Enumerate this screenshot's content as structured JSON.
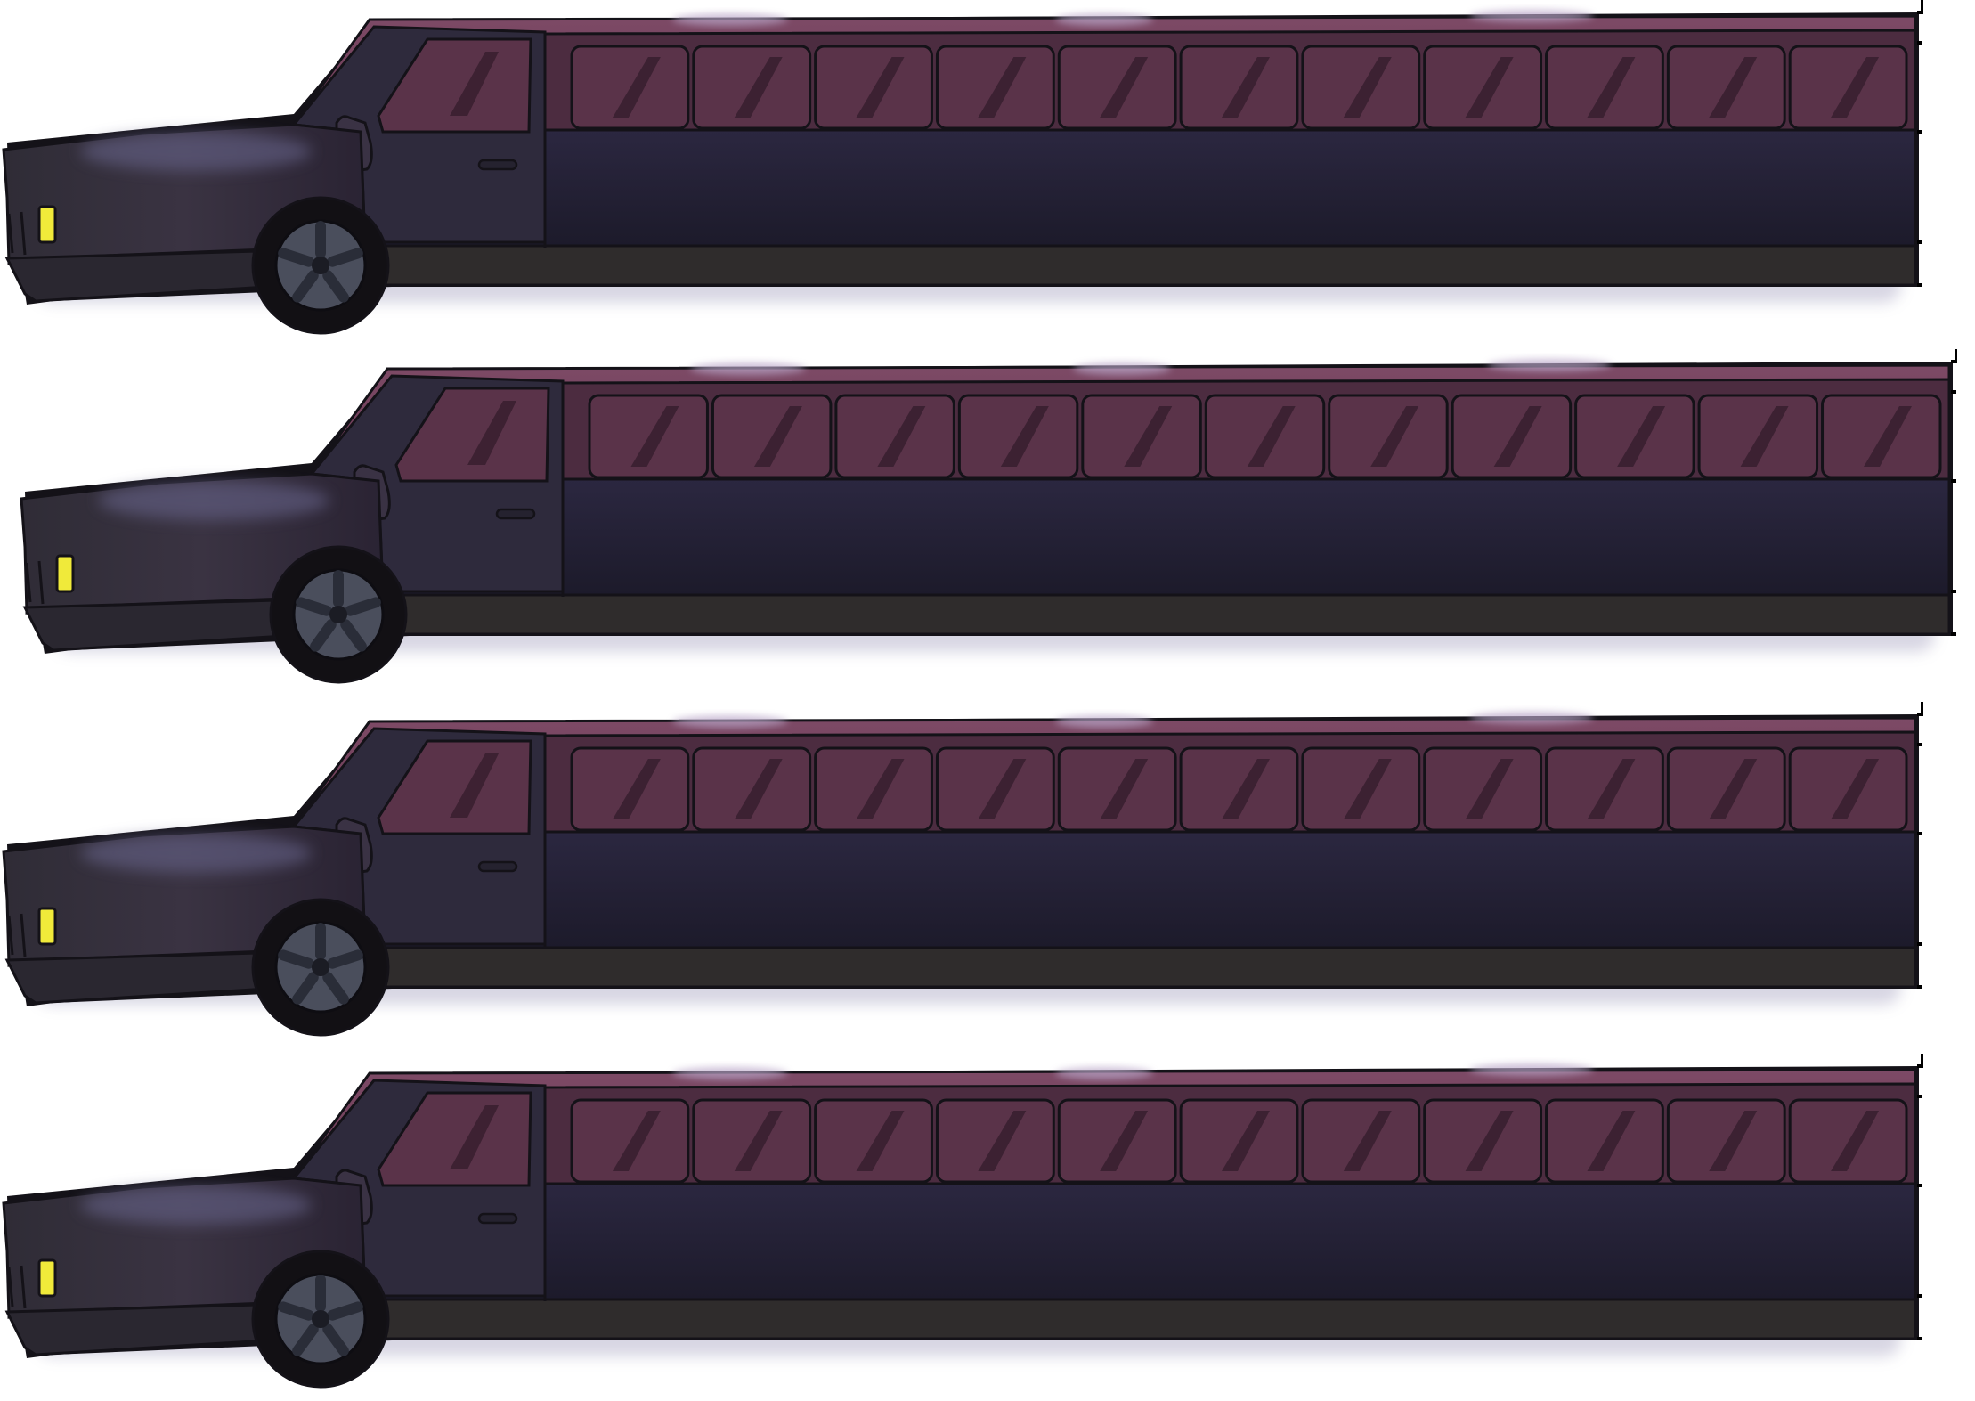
{
  "sprite_sheet": {
    "subject": "limousine",
    "frames": [
      {
        "index": 1,
        "pose": "idle"
      },
      {
        "index": 2,
        "pose": "bounce"
      },
      {
        "index": 3,
        "pose": "idle"
      },
      {
        "index": 4,
        "pose": "idle"
      }
    ],
    "colors": {
      "roof": "#6b3b55",
      "roof_highlight": "#a37a9b",
      "roof_shine": "#b9a6c8",
      "window_band": "#4c2c40",
      "window_glass": "#5a3349",
      "body": "#262338",
      "body_dark": "#1c1a2a",
      "rocker": "#2f2c2c",
      "hood": "#2a2530",
      "outline": "#141218",
      "headlight": "#f0ea3a",
      "hubcap": "#4a4e5c",
      "tire": "#121014",
      "glow": "#8f8ab0"
    },
    "window_count": 11
  }
}
